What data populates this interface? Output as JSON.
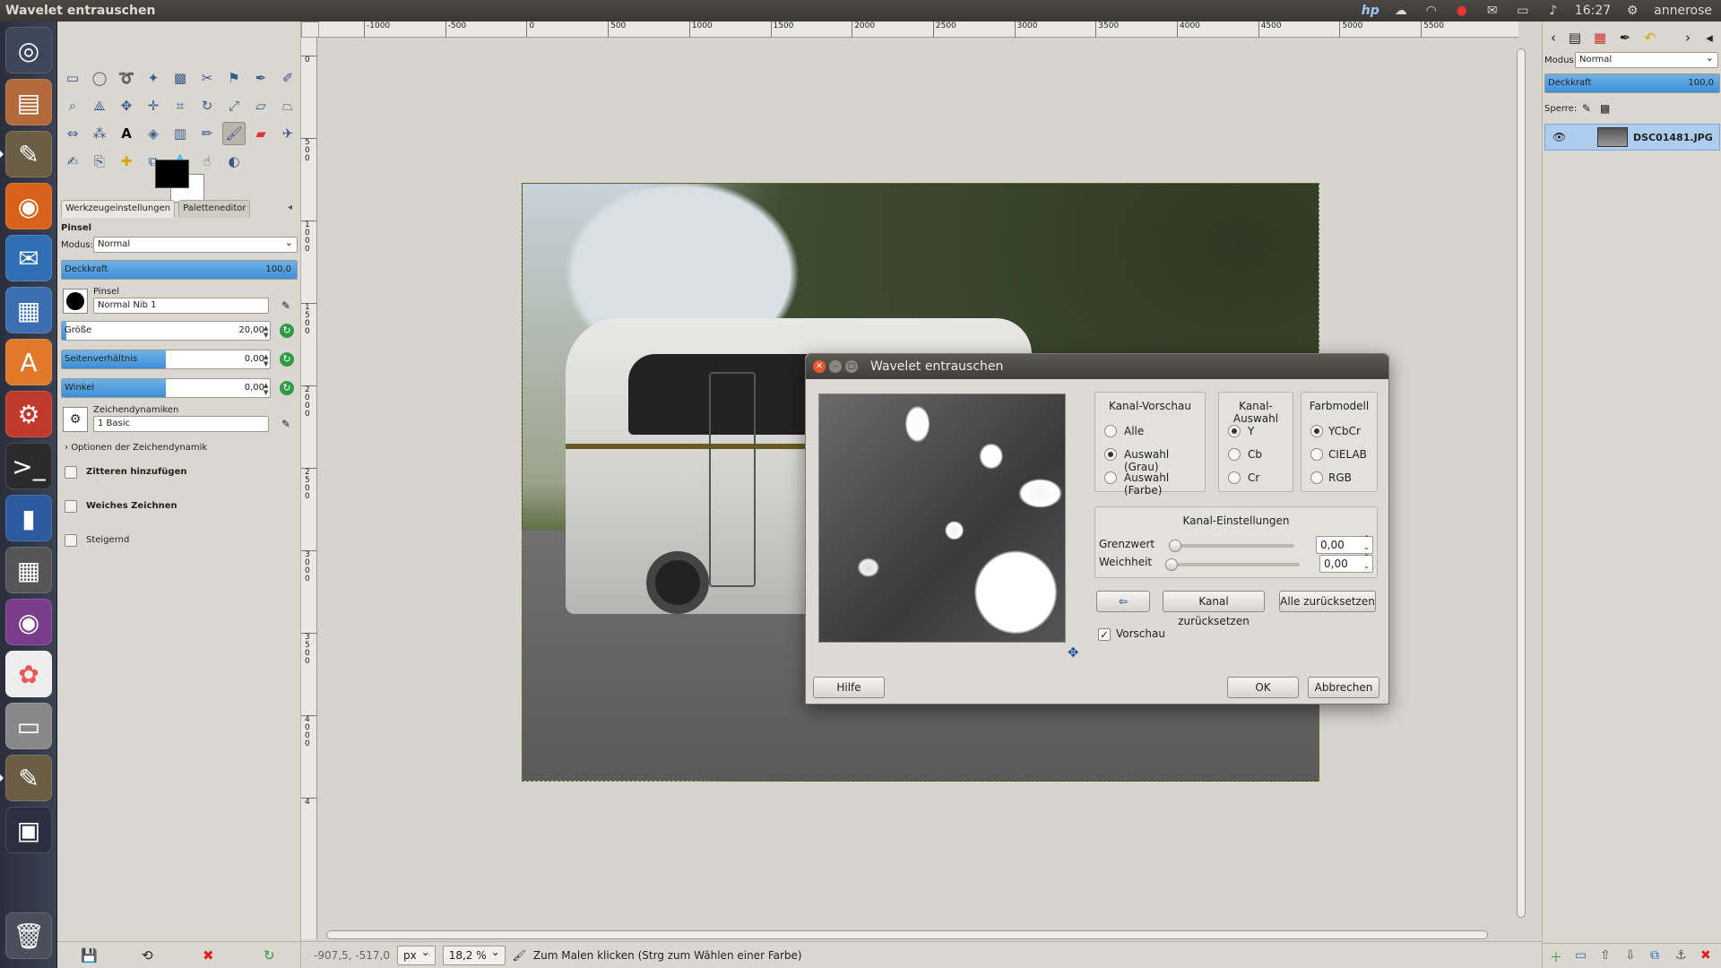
{
  "window_title": "Wavelet entrauschen",
  "topbar": {
    "time": "16:27",
    "user": "annerose",
    "tray_icons": [
      "hp-icon",
      "cloud-icon",
      "wifi-icon",
      "record-icon",
      "mail-icon",
      "battery-icon",
      "volume-icon"
    ]
  },
  "launcher": {
    "items": [
      "dash-home",
      "files",
      "gimp",
      "firefox",
      "thunderbird",
      "writer",
      "software-center",
      "system-settings",
      "terminal",
      "sd-card",
      "calculator",
      "eye-of-gnome",
      "photo-app",
      "scanner",
      "gimp-2",
      "workspaces",
      "trash"
    ]
  },
  "toolbox": {
    "tab_tool_options": "Werkzeugeinstellungen",
    "tab_palette": "Paletteneditor",
    "tool_name": "Pinsel",
    "mode_label": "Modus:",
    "mode_value": "Normal",
    "opacity_label": "Deckkraft",
    "opacity_value": "100,0",
    "brush_label": "Pinsel",
    "brush_value": "Normal Nib 1",
    "size_label": "Größe",
    "size_value": "20,00",
    "aspect_label": "Seitenverhältnis",
    "aspect_value": "0,00",
    "angle_label": "Winkel",
    "angle_value": "0,00",
    "dynamics_label": "Zeichendynamiken",
    "dynamics_value": "1 Basic",
    "dynamics_options": "Optionen der Zeichendynamik",
    "jitter": "Zitteren hinzufügen",
    "smooth": "Weiches Zeichnen",
    "incremental": "Steigernd"
  },
  "ruler": {
    "top_ticks": [
      "-1000",
      "-500",
      "0",
      "500",
      "1000",
      "1500",
      "2000",
      "2500",
      "3000",
      "3500",
      "4000",
      "4500",
      "5000",
      "5500"
    ],
    "left_ticks": [
      "0",
      "5\n0\n0",
      "1\n0\n0\n0",
      "1\n5\n0\n0",
      "2\n0\n0\n0",
      "2\n5\n0\n0",
      "3\n0\n0\n0",
      "3\n5\n0\n0",
      "4\n0\n0\n0",
      "4"
    ]
  },
  "statusbar": {
    "coords": "-907,5, -517,0",
    "unit": "px",
    "zoom": "18,2 %",
    "message": "Zum Malen klicken (Strg zum Wählen einer Farbe)"
  },
  "dialog": {
    "title": "Wavelet entrauschen",
    "preview_frame": {
      "title": "Kanal-Vorschau",
      "options": [
        "Alle",
        "Auswahl (Grau)",
        "Auswahl (Farbe)"
      ],
      "selected": "Auswahl (Grau)"
    },
    "channel_frame": {
      "title": "Kanal-Auswahl",
      "options": [
        "Y",
        "Cb",
        "Cr"
      ],
      "selected": "Y"
    },
    "color_model_frame": {
      "title": "Farbmodell",
      "options": [
        "YCbCr",
        "CIELAB",
        "RGB"
      ],
      "selected": "YCbCr"
    },
    "settings": {
      "title": "Kanal-Einstellungen",
      "threshold_label": "Grenzwert",
      "threshold_value": "0,00",
      "softness_label": "Weichheit",
      "softness_value": "0,00"
    },
    "reset_channel": "Kanal zurücksetzen",
    "reset_all": "Alle zurücksetzen",
    "preview_label": "Vorschau",
    "preview_checked": true,
    "help": "Hilfe",
    "ok": "OK",
    "cancel": "Abbrechen"
  },
  "dock": {
    "mode_label": "Modus:",
    "mode_value": "Normal",
    "opacity_label": "Deckkraft",
    "opacity_value": "100,0",
    "lock_label": "Sperre:",
    "layer_name": "DSC01481.JPG"
  }
}
